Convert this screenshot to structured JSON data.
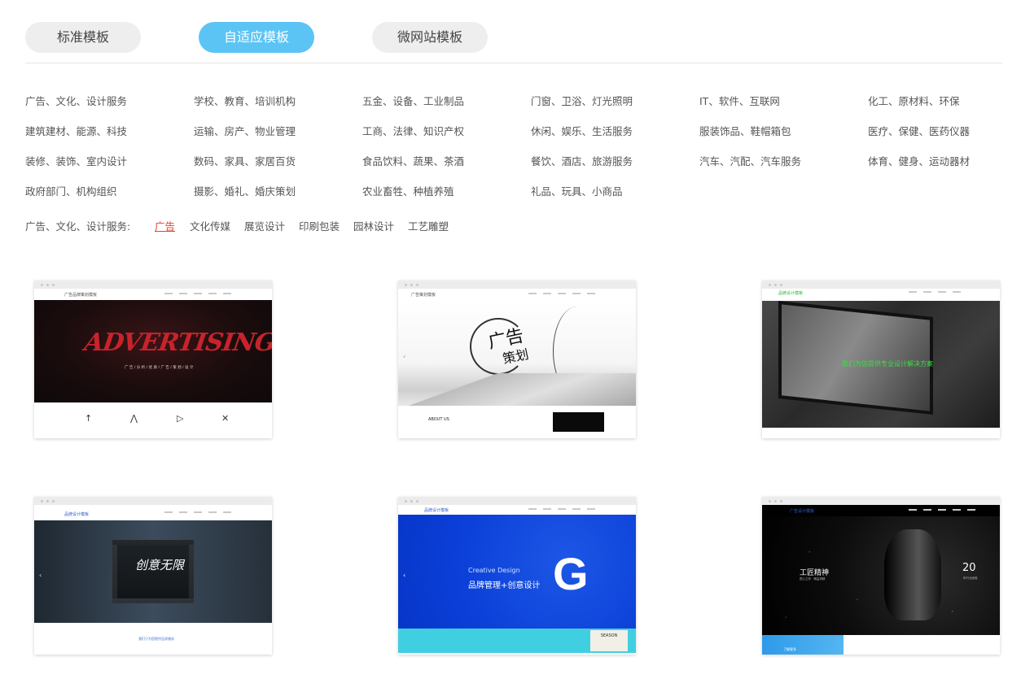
{
  "tabs": [
    {
      "label": "标准模板",
      "active": false
    },
    {
      "label": "自适应模板",
      "active": true
    },
    {
      "label": "微网站模板",
      "active": false
    }
  ],
  "categories": [
    [
      "广告、文化、设计服务",
      "学校、教育、培训机构",
      "五金、设备、工业制品",
      "门窗、卫浴、灯光照明",
      "IT、软件、互联网",
      "化工、原材料、环保"
    ],
    [
      "建筑建材、能源、科技",
      "运输、房产、物业管理",
      "工商、法律、知识产权",
      "休闲、娱乐、生活服务",
      "服装饰品、鞋帽箱包",
      "医疗、保健、医药仪器"
    ],
    [
      "装修、装饰、室内设计",
      "数码、家具、家居百货",
      "食品饮料、蔬果、茶酒",
      "餐饮、酒店、旅游服务",
      "汽车、汽配、汽车服务",
      "体育、健身、运动器材"
    ],
    [
      "政府部门、机构组织",
      "摄影、婚礼、婚庆策划",
      "农业畜牲、种植养殖",
      "礼品、玩具、小商品"
    ]
  ],
  "subcategory": {
    "label": "广告、文化、设计服务:",
    "links": [
      "广告",
      "文化传媒",
      "展览设计",
      "印刷包装",
      "园林设计",
      "工艺雕塑"
    ],
    "active_index": 0
  },
  "templates": [
    {
      "brand": "广告品牌策划模板",
      "hero_title": "ADVERTISING",
      "hero_sub": "广 告 / 分 析 / 优 质 / 广 告 / 策 划 / 设 计",
      "icons": [
        "↑",
        "⋀",
        "▷",
        "✕"
      ]
    },
    {
      "brand": "广告策划模板",
      "hero_title": "广告",
      "hero_title2": "策划",
      "section": "ABOUT US"
    },
    {
      "brand": "品牌设计模板",
      "hero_title": "我们为您提供专业设计解决方案"
    },
    {
      "brand": "品牌设计模板",
      "hero_title": "创意无限",
      "link_text": "我们只为您提供品质服务"
    },
    {
      "brand": "品牌设计模板",
      "hero_title": "Creative Design",
      "hero_sub": "品牌管理+创意设计",
      "letter": "G",
      "promo": "SEASON"
    },
    {
      "brand": "广告设计模板",
      "hero_title": "工匠精神",
      "hero_sub": "匠心之作 · 精益求精",
      "number": "20",
      "number_sub": "年行业经验",
      "button": "了解更多"
    }
  ],
  "colors": {
    "accent": "#5bc4f5",
    "active_link": "#e4462a",
    "tab_bg": "#eeeeee"
  }
}
